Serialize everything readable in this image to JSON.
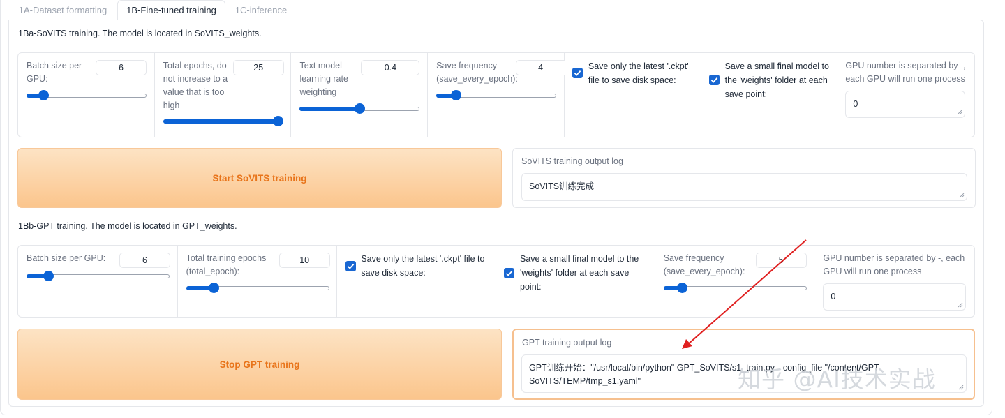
{
  "tabs": [
    {
      "label": "1A-Dataset formatting",
      "selected": false
    },
    {
      "label": "1B-Fine-tuned training",
      "selected": true
    },
    {
      "label": "1C-inference",
      "selected": false
    }
  ],
  "sovits": {
    "title": "1Ba-SoVITS training. The model is located in SoVITS_weights.",
    "batch_size": {
      "label": "Batch size per GPU:",
      "value": "6",
      "slider_fraction": 0.14
    },
    "total_epochs": {
      "label": "Total epochs, do not increase to a value that is too high",
      "value": "25",
      "slider_fraction": 1.0
    },
    "text_lr_weight": {
      "label": "Text model learning rate weighting",
      "value": "0.4",
      "slider_fraction": 0.5
    },
    "save_frequency": {
      "label": "Save frequency (save_every_epoch):",
      "value": "4",
      "slider_fraction": 0.16
    },
    "save_latest_only": {
      "label": "Save only the latest '.ckpt' file to save disk space:",
      "checked": true
    },
    "save_small_final": {
      "label": "Save a small final model to the 'weights' folder at each save point:",
      "checked": true
    },
    "gpu_numbers": {
      "label": "GPU number is separated by -, each GPU will run one process",
      "value": "0"
    },
    "start_button": "Start SoVITS training",
    "log_label": "SoVITS training output log",
    "log_value": "SoVITS训练完成"
  },
  "gpt": {
    "title": "1Bb-GPT training. The model is located in GPT_weights.",
    "batch_size": {
      "label": "Batch size per GPU:",
      "value": "6",
      "slider_fraction": 0.15
    },
    "total_epochs": {
      "label": "Total training epochs (total_epoch):",
      "value": "10",
      "slider_fraction": 0.19
    },
    "save_latest_only": {
      "label": "Save only the latest '.ckpt' file to save disk space:",
      "checked": true
    },
    "save_small_final": {
      "label": "Save a small final model to the 'weights' folder at each save point:",
      "checked": true
    },
    "save_frequency": {
      "label": "Save frequency (save_every_epoch):",
      "value": "5",
      "slider_fraction": 0.13
    },
    "gpu_numbers": {
      "label": "GPU number is separated by -, each GPU will run one process",
      "value": "0"
    },
    "stop_button": "Stop GPT training",
    "log_label": "GPT training output log",
    "log_value": "GPT训练开始：\"/usr/local/bin/python\" GPT_SoVITS/s1_train.py --config_file \"/content/GPT-SoVITS/TEMP/tmp_s1.yaml\""
  },
  "watermark": "知乎 @AI技术实战",
  "colors": {
    "accent": "#0b63d6",
    "button_text": "#e8741a",
    "button_bg": "#fbc58c",
    "annotation_arrow": "#e02020"
  }
}
